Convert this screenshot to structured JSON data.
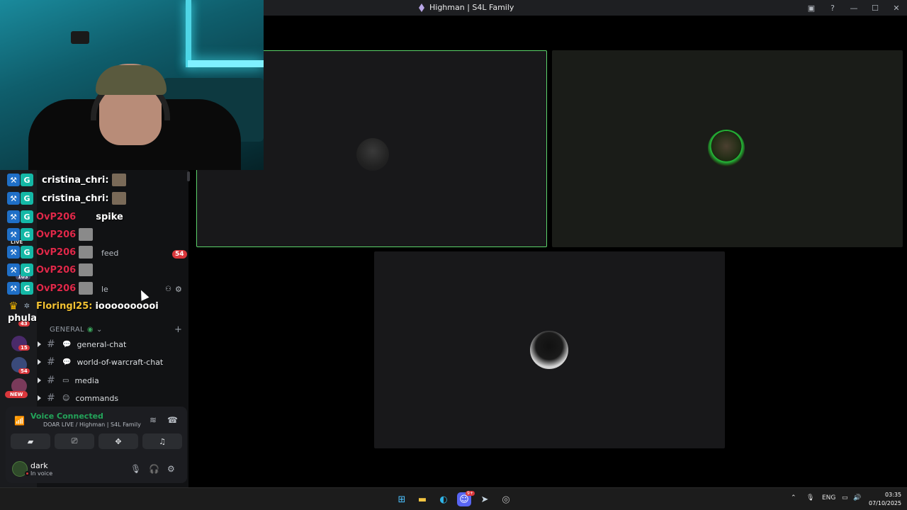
{
  "window": {
    "title": "Highman | S4L Family"
  },
  "chat_overlay": [
    {
      "user": "cristina_chri:",
      "message": "",
      "style": "white"
    },
    {
      "user": "cristina_chri:",
      "message": "",
      "style": "white"
    },
    {
      "user": "OvP206",
      "message": "spike",
      "style": "red"
    },
    {
      "user": "OvP206",
      "message": "",
      "style": "red"
    },
    {
      "user": "OvP206",
      "message": "",
      "style": "red"
    },
    {
      "user": "OvP206",
      "message": "",
      "style": "red"
    },
    {
      "user": "OvP206",
      "message": "",
      "style": "red"
    },
    {
      "user": "Floringl25:",
      "message": "ioooooooooi",
      "style": "yellow"
    }
  ],
  "sidebar": {
    "partial_channels": [
      {
        "label": "feed",
        "unread": "54"
      },
      {
        "label": "le"
      }
    ],
    "category": "GENERAL",
    "channels": [
      {
        "name": "general-chat",
        "icon": "speech-bubble-icon"
      },
      {
        "name": "world-of-warcraft-chat",
        "icon": "speech-bubble-icon"
      },
      {
        "name": "media",
        "icon": "image-icon"
      },
      {
        "name": "commands",
        "icon": "robot-icon"
      }
    ],
    "phula": "phula",
    "guild_badges": [
      "43",
      "15",
      "54"
    ],
    "new_label": "NEW",
    "side_labels": [
      "LIVE",
      "103"
    ]
  },
  "voice": {
    "status": "Voice Connected",
    "location": "DOAR LIVE / Highman | S4L Family"
  },
  "user": {
    "name": "dark",
    "status": "In voice"
  },
  "taskbar": {
    "language": "ENG",
    "time": "03:35",
    "date": "07/10/2025",
    "discord_badge": "9+"
  },
  "colors": {
    "speaking_border": "#5bd36a",
    "voice_connected": "#23a55a",
    "unread_badge": "#da373c"
  }
}
